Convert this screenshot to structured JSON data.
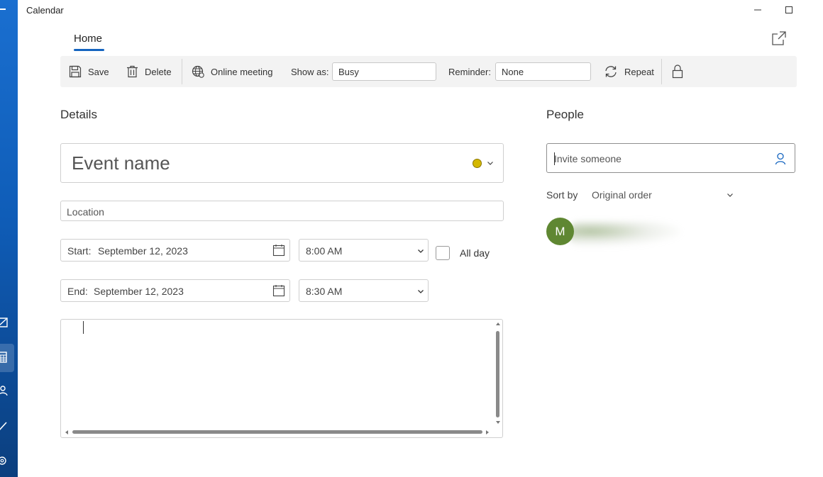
{
  "window": {
    "title": "Calendar"
  },
  "tabs": {
    "home": "Home"
  },
  "toolbar": {
    "save": "Save",
    "delete": "Delete",
    "online_meeting": "Online meeting",
    "show_as_label": "Show as:",
    "show_as_value": "Busy",
    "reminder_label": "Reminder:",
    "reminder_value": "None",
    "repeat": "Repeat"
  },
  "details": {
    "heading": "Details",
    "event_name_placeholder": "Event name",
    "event_color": "#d4b800",
    "location_placeholder": "Location",
    "start_label": "Start:",
    "start_date": "September 12, 2023",
    "start_time": "8:00 AM",
    "end_label": "End:",
    "end_date": "September 12, 2023",
    "end_time": "8:30 AM",
    "all_day_label": "All day",
    "all_day_checked": false
  },
  "people": {
    "heading": "People",
    "invite_placeholder": "Invite someone",
    "sort_label": "Sort by",
    "sort_value": "Original order",
    "attendees": [
      {
        "initial": "M",
        "color": "#5f8732"
      }
    ]
  },
  "colors": {
    "accent": "#1565c0",
    "rail": "#1a6fd0"
  }
}
